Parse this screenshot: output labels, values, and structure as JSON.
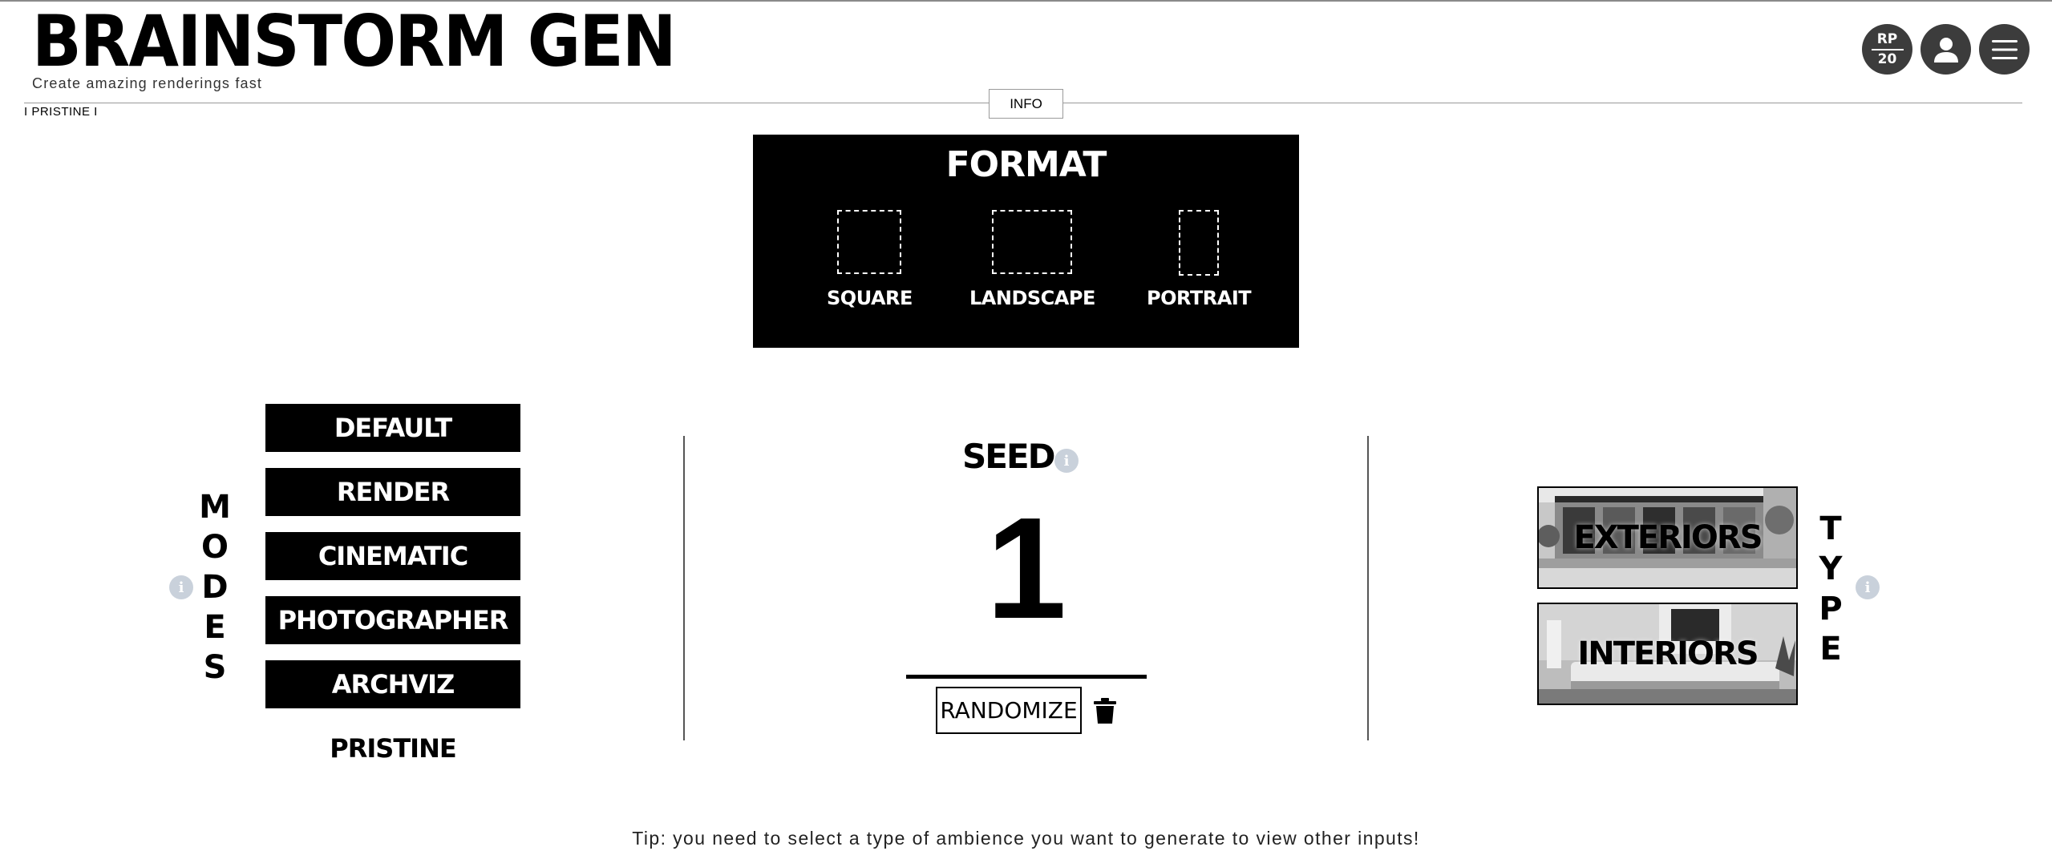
{
  "header": {
    "title": "BRAINSTORM GEN",
    "subtitle": "Create amazing renderings fast",
    "breadcrumb": "I PRISTINE I",
    "info_label": "INFO",
    "rp_badge": {
      "top": "RP",
      "bottom": "20"
    },
    "icons": [
      "account-icon",
      "hamburger-menu-icon"
    ]
  },
  "format": {
    "title": "FORMAT",
    "options": [
      {
        "label": "SQUARE"
      },
      {
        "label": "LANDSCAPE"
      },
      {
        "label": "PORTRAIT"
      }
    ]
  },
  "modes": {
    "heading_letters": [
      "M",
      "O",
      "D",
      "E",
      "S"
    ],
    "items": [
      {
        "label": "DEFAULT"
      },
      {
        "label": "RENDER"
      },
      {
        "label": "CINEMATIC"
      },
      {
        "label": "PHOTOGRAPHER"
      },
      {
        "label": "ARCHVIZ"
      },
      {
        "label": "PRISTINE"
      }
    ],
    "selected": "PRISTINE"
  },
  "seed": {
    "title": "SEED",
    "value": "1",
    "randomize_label": "RANDOMIZE"
  },
  "type": {
    "heading_letters": [
      "T",
      "Y",
      "P",
      "E"
    ],
    "items": [
      {
        "label": "EXTERIORS"
      },
      {
        "label": "INTERIORS"
      }
    ]
  },
  "tip": "Tip: you need to select a type of ambience you want to generate to view other inputs!",
  "colors": {
    "panel": "#000000",
    "icon_circle": "#3c3c3c",
    "info_dot": "#c9d1db"
  }
}
